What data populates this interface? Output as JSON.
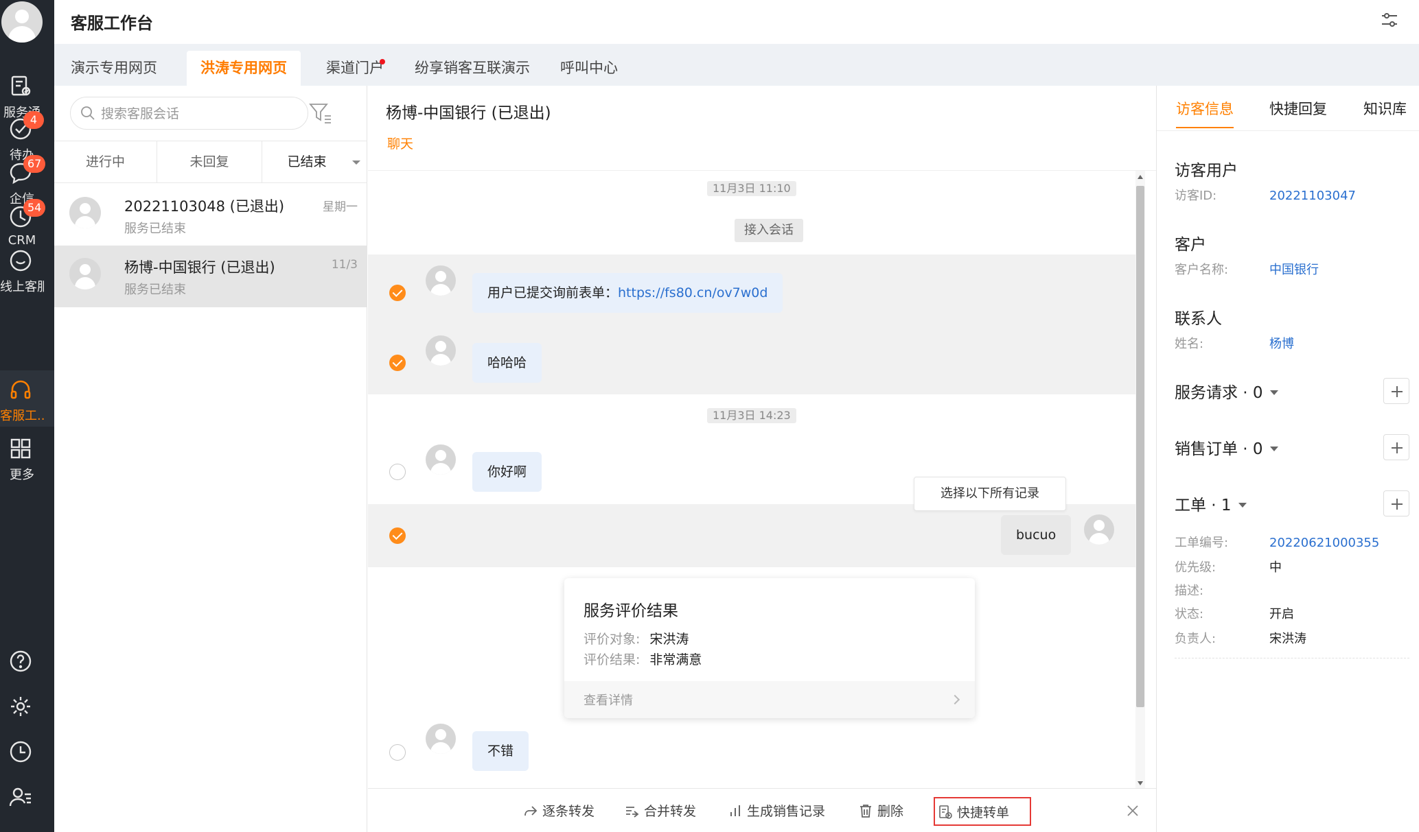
{
  "app": {
    "title": "客服工作台"
  },
  "rail": {
    "items": [
      {
        "label": "服务通",
        "icon": "service-icon"
      },
      {
        "label": "待办",
        "icon": "todo-check-icon",
        "badge": "4"
      },
      {
        "label": "企信",
        "icon": "chat-icon",
        "badge": "67"
      },
      {
        "label": "CRM",
        "icon": "clock-icon",
        "badge": "54"
      },
      {
        "label": "线上客服",
        "icon": "smile-icon"
      },
      {
        "label": "客服工...",
        "icon": "headset-icon",
        "active": true
      },
      {
        "label": "更多",
        "icon": "grid-icon"
      }
    ],
    "bottom_icons": [
      "help-icon",
      "settings-gear-icon",
      "history-clock-icon",
      "user-list-icon"
    ]
  },
  "tabs": [
    {
      "label": "演示专用网页"
    },
    {
      "label": "洪涛专用网页",
      "active": true
    },
    {
      "label": "渠道门户",
      "dot": true
    },
    {
      "label": "纷享销客互联演示"
    },
    {
      "label": "呼叫中心"
    }
  ],
  "sessions": {
    "search_placeholder": "搜索客服会话",
    "filters": [
      "进行中",
      "未回复",
      "已结束"
    ],
    "active_filter": "已结束",
    "items": [
      {
        "name": "20221103048 (已退出)",
        "status": "服务已结束",
        "time": "星期一"
      },
      {
        "name": "杨博-中国银行 (已退出)",
        "status": "服务已结束",
        "time": "11/3",
        "active": true
      }
    ]
  },
  "chat": {
    "title": "杨博-中国银行 (已退出)",
    "subtab": "聊天",
    "timestamp1": "11月3日 11:10",
    "system_msg": "接入会话",
    "msg1_prefix": "用户已提交询前表单：",
    "msg1_link": "https://fs80.cn/ov7w0d",
    "msg2": "哈哈哈",
    "timestamp2": "11月3日 14:23",
    "msg3": "你好啊",
    "select_all_tip": "选择以下所有记录",
    "msg4": "bucuo",
    "rating_card": {
      "title": "服务评价结果",
      "target_label": "评价对象:",
      "target_value": "宋洪涛",
      "result_label": "评价结果:",
      "result_value": "非常满意",
      "details": "查看详情"
    },
    "msg5": "不错"
  },
  "actions": [
    {
      "label": "逐条转发",
      "icon": "forward-icon"
    },
    {
      "label": "合并转发",
      "icon": "merge-forward-icon"
    },
    {
      "label": "生成销售记录",
      "icon": "bar-chart-icon"
    },
    {
      "label": "删除",
      "icon": "trash-icon"
    },
    {
      "label": "快捷转单",
      "icon": "quick-order-icon",
      "highlighted": true
    }
  ],
  "panel": {
    "tabs": [
      {
        "label": "访客信息",
        "active": true
      },
      {
        "label": "快捷回复"
      },
      {
        "label": "知识库"
      }
    ],
    "visitor": {
      "title": "访客用户",
      "id_label": "访客ID:",
      "id_value": "20221103047"
    },
    "customer": {
      "title": "客户",
      "name_label": "客户名称:",
      "name_value": "中国银行"
    },
    "contact": {
      "title": "联系人",
      "name_label": "姓名:",
      "name_value": "杨博"
    },
    "service_req": {
      "title": "服务请求 · 0"
    },
    "sales_order": {
      "title": "销售订单 · 0"
    },
    "work_order": {
      "title": "工单 · 1",
      "fields": [
        {
          "label": "工单编号:",
          "value": "20220621000355",
          "link": true
        },
        {
          "label": "优先级:",
          "value": "中"
        },
        {
          "label": "描述:",
          "value": ""
        },
        {
          "label": "状态:",
          "value": "开启"
        },
        {
          "label": "负责人:",
          "value": "宋洪涛"
        }
      ]
    }
  },
  "colors": {
    "accent": "#ff8000",
    "rail_bg": "#23282f",
    "link": "#2a6fcf",
    "badge": "#ff5b3a"
  }
}
